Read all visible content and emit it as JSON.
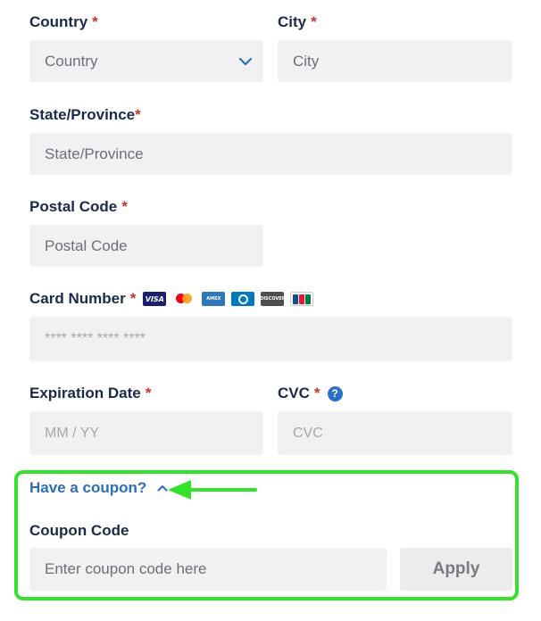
{
  "country": {
    "label": "Country",
    "required": "*",
    "placeholder": "Country"
  },
  "city": {
    "label": "City",
    "required": "*",
    "placeholder": "City"
  },
  "state": {
    "label": "State/Province",
    "required": "*",
    "placeholder": "State/Province"
  },
  "postal": {
    "label": "Postal Code",
    "required": "*",
    "placeholder": "Postal Code"
  },
  "card_number": {
    "label": "Card Number",
    "required": "*",
    "placeholder": "**** **** **** ****",
    "brands": {
      "visa": "VISA",
      "amex": "AMEX",
      "discover": "DISCOVER"
    }
  },
  "expiration": {
    "label": "Expiration Date",
    "required": "*",
    "placeholder": "MM / YY"
  },
  "cvc": {
    "label": "CVC",
    "required": "*",
    "placeholder": "CVC",
    "help": "?"
  },
  "coupon": {
    "toggle_label": "Have a coupon?",
    "code_label": "Coupon Code",
    "placeholder": "Enter coupon code here",
    "apply_label": "Apply"
  },
  "colors": {
    "label_text": "#1b2a4a",
    "required": "#c0392b",
    "field_bg": "#f1f1f3",
    "link": "#2f6db3",
    "highlight": "#35e22a"
  }
}
